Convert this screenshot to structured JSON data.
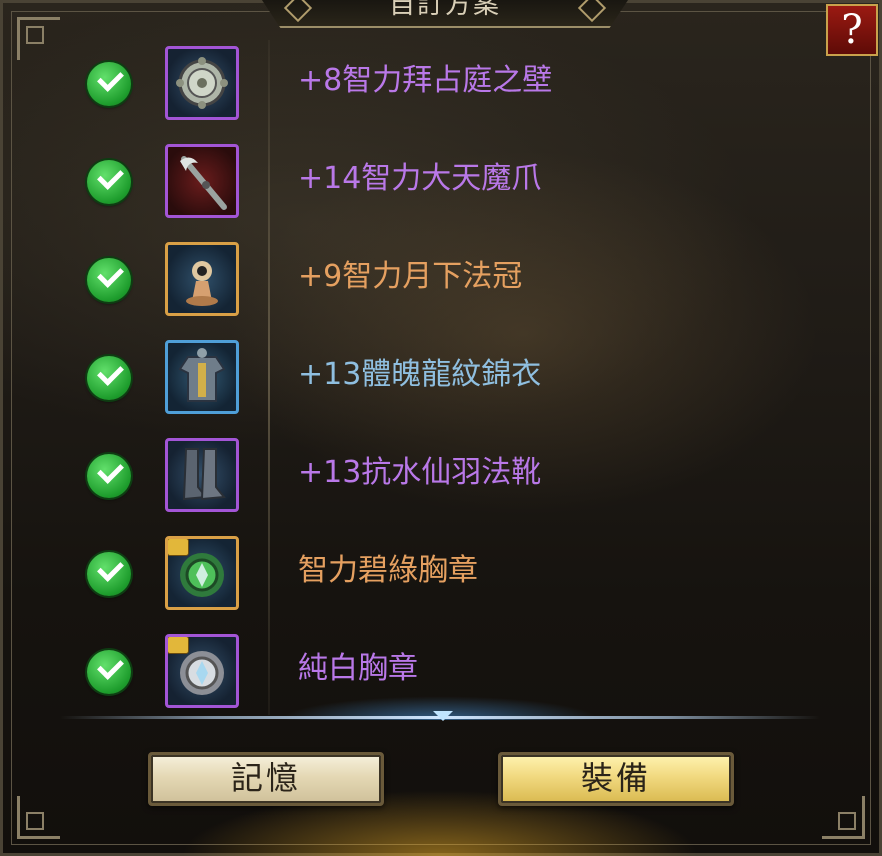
{
  "header": {
    "title": "自訂方案",
    "help_label": "?"
  },
  "items": [
    {
      "name": "+8智力拜占庭之壁",
      "color": "#b978e8",
      "frame": "purple",
      "icon": "shield-icon",
      "locked": false,
      "equipped": true
    },
    {
      "name": "+14智力大天魔爪",
      "color": "#b978e8",
      "frame": "purple",
      "icon": "claw-weapon-icon",
      "locked": false,
      "equipped": true
    },
    {
      "name": "+9智力月下法冠",
      "color": "#e5a060",
      "frame": "orange",
      "icon": "hat-icon",
      "locked": false,
      "equipped": true
    },
    {
      "name": "+13體魄龍紋錦衣",
      "color": "#8fbfe0",
      "frame": "blue",
      "icon": "armor-icon",
      "locked": false,
      "equipped": true
    },
    {
      "name": "+13抗水仙羽法靴",
      "color": "#b978e8",
      "frame": "purple",
      "icon": "boots-icon",
      "locked": false,
      "equipped": true
    },
    {
      "name": "智力碧綠胸章",
      "color": "#e5a060",
      "frame": "orange",
      "icon": "green-badge-icon",
      "locked": true,
      "equipped": true
    },
    {
      "name": "純白胸章",
      "color": "#b978e8",
      "frame": "purple",
      "icon": "white-badge-icon",
      "locked": true,
      "equipped": true
    }
  ],
  "buttons": {
    "memo": "記憶",
    "equip": "裝備"
  }
}
